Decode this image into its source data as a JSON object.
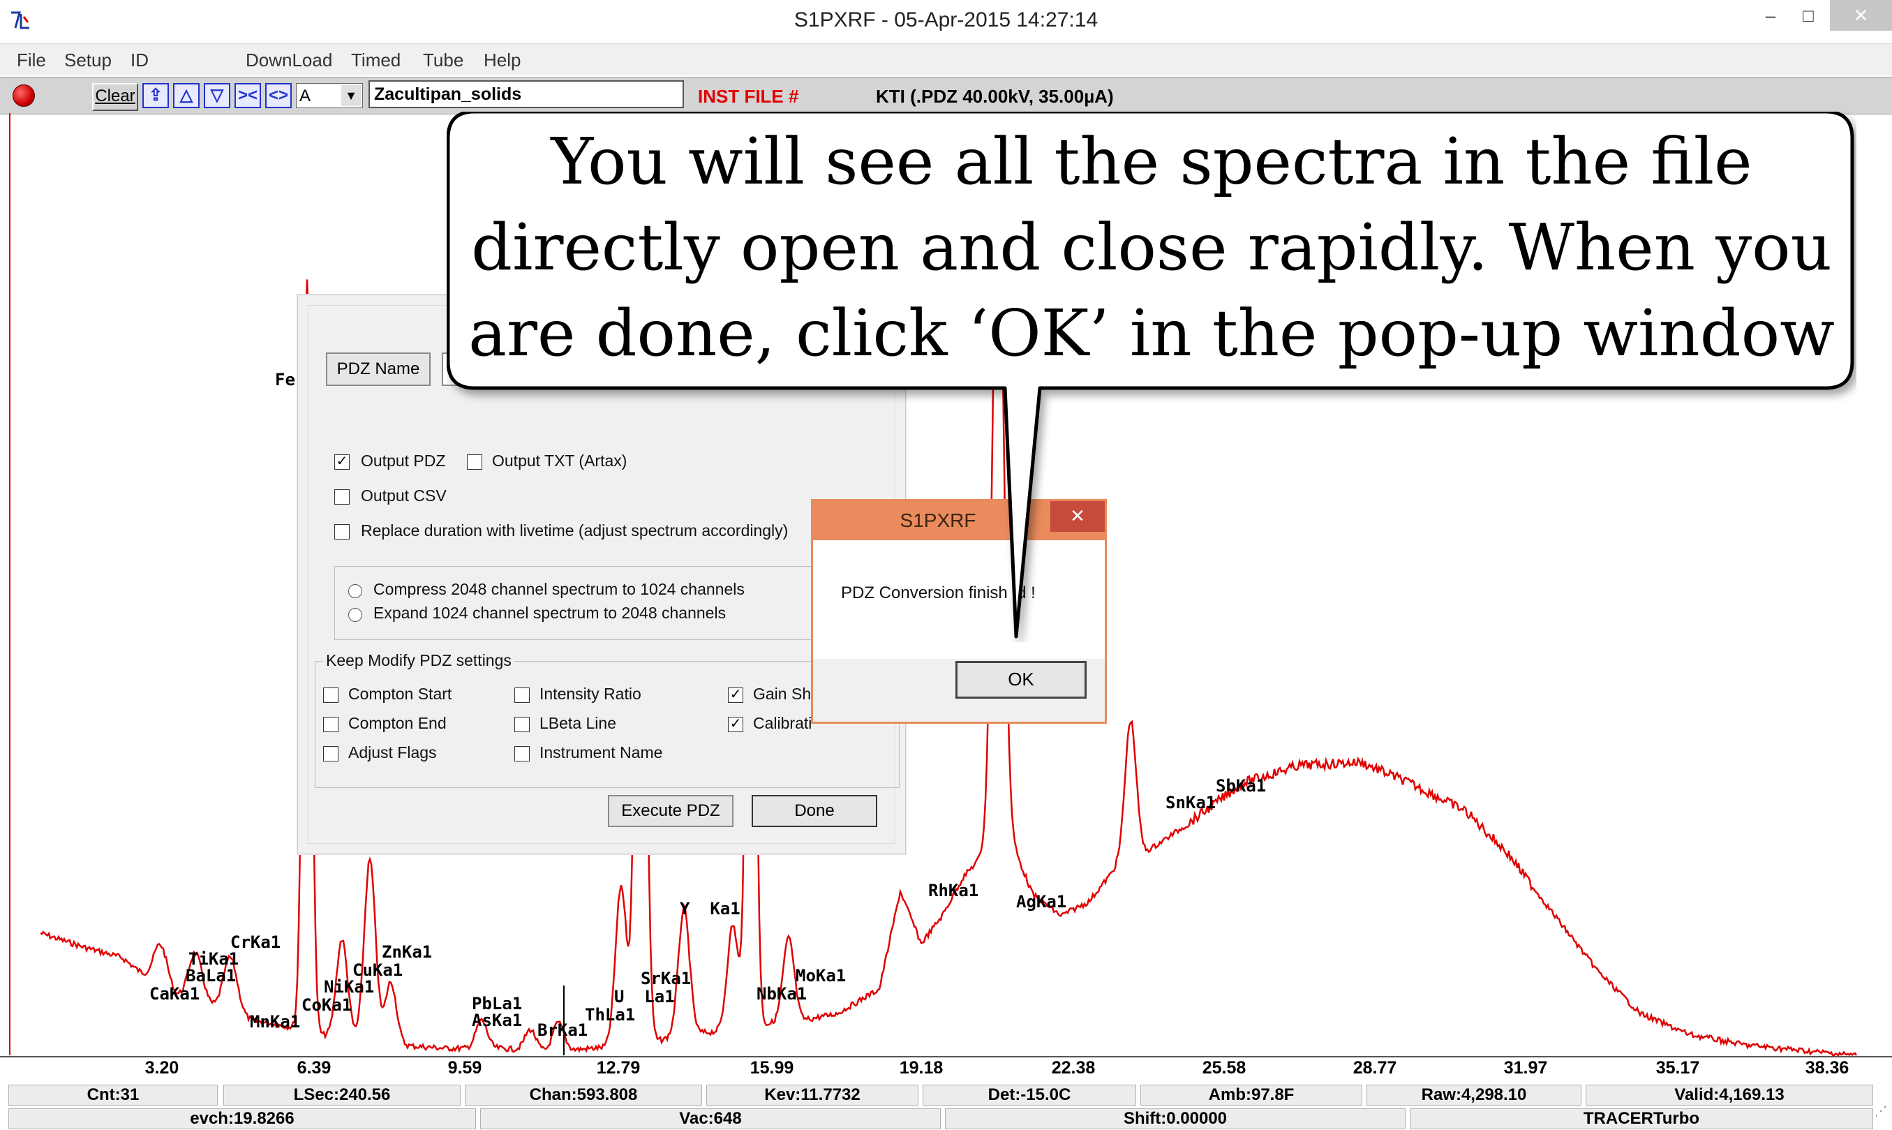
{
  "window": {
    "title": "S1PXRF - 05-Apr-2015 14:27:14",
    "minimize_glyph": "–",
    "maximize_glyph": "□",
    "close_glyph": "✕"
  },
  "menu": [
    "File",
    "Setup",
    "ID",
    "DownLoad",
    "Timed",
    "Tube",
    "Help"
  ],
  "toolbar": {
    "clear_label": "Clear",
    "combo_value": "A",
    "file_name": "Zacultipan_solids",
    "inst_file": "INST FILE #",
    "tube_info": "KTI  (.PDZ 40.00kV, 35.00µA)",
    "icons": [
      "home-up-icon",
      "arrow-up-icon",
      "arrow-down-icon",
      "collapse-icon",
      "expand-icon"
    ]
  },
  "axis": {
    "ticks": [
      "3.20",
      "6.39",
      "9.59",
      "12.79",
      "15.99",
      "19.18",
      "22.38",
      "25.58",
      "28.77",
      "31.97",
      "35.17",
      "38.36"
    ]
  },
  "element_labels": [
    "CrKa1",
    "TiKa1",
    "BaLa1",
    "CaKa1",
    "MnKa1",
    "CoKa1",
    "NiKa1",
    "CuKa1",
    "ZnKa1",
    "PbLa1",
    "AsKa1",
    "BrKa1",
    "U  La1",
    "ThLa1",
    "SrKa1",
    "Y  Ka1",
    "NbKa1",
    "MoKa1",
    "RhKa1",
    "AgKa1",
    "SnKa1",
    "SbKa1",
    "Fe"
  ],
  "status": {
    "cnt": "Cnt:31",
    "lsec": "LSec:240.56",
    "chan": "Chan:593.808",
    "kev": "Kev:11.7732",
    "det": "Det:-15.0C",
    "amb": "Amb:97.8F",
    "raw": "Raw:4,298.10",
    "valid": "Valid:4,169.13",
    "evch": "evch:19.8266",
    "vac": "Vac:648",
    "shift": "Shift:0.00000",
    "model": "TRACERTurbo"
  },
  "pdz_dialog": {
    "pdz_name_button": "PDZ Name",
    "output_pdz": "Output PDZ",
    "output_txt": "Output TXT (Artax)",
    "output_csv": "Output CSV",
    "replace_duration": "Replace duration with livetime (adjust spectrum accordingly)",
    "compress": "Compress 2048 channel spectrum to 1024 channels",
    "expand": "Expand 1024 channel spectrum to 2048 channels",
    "group_title": "Keep Modify PDZ settings",
    "compton_start": "Compton Start",
    "compton_end": "Compton End",
    "adjust_flags": "Adjust Flags",
    "intensity_ratio": "Intensity Ratio",
    "lbeta_line": "LBeta Line",
    "instrument_name": "Instrument Name",
    "gain_shift": "Gain Sh",
    "calibration": "Calibrati",
    "execute_button": "Execute PDZ",
    "done_button": "Done",
    "checked": {
      "output_pdz": true,
      "gain_shift": true,
      "calibration": true
    }
  },
  "message_box": {
    "title": "S1PXRF",
    "text": "PDZ Conversion finish  d !",
    "ok_label": "OK"
  },
  "callout": {
    "line1": "You will see all the spectra in the file",
    "line2": "directly open and close rapidly. When you",
    "line3": "are done, click ‘OK’ in the pop-up window"
  },
  "colors": {
    "spectrum": "#e00000",
    "inst_file": "#e00000",
    "msgbox_accent": "#e98b5c"
  }
}
